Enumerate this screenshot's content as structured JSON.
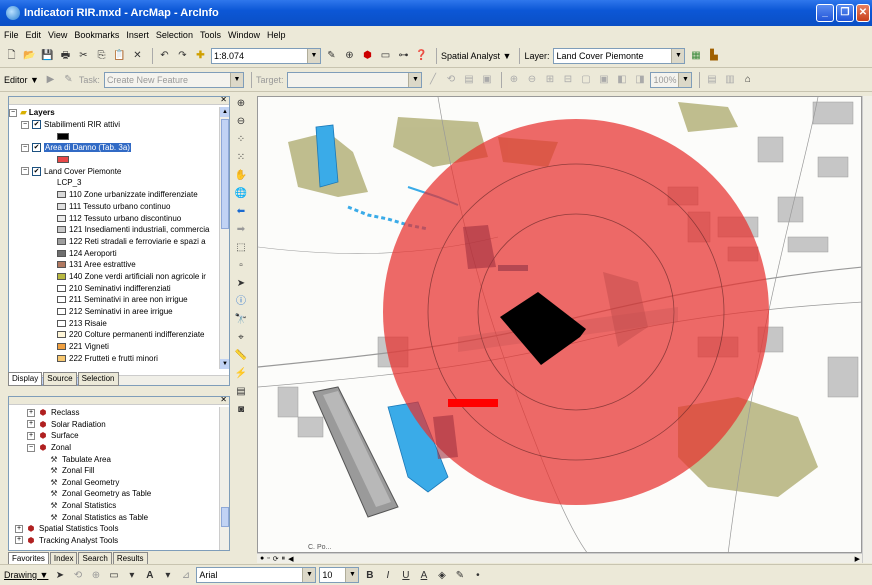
{
  "window": {
    "title": "Indicatori RIR.mxd - ArcMap - ArcInfo"
  },
  "menu": [
    "File",
    "Edit",
    "View",
    "Bookmarks",
    "Insert",
    "Selection",
    "Tools",
    "Window",
    "Help"
  ],
  "standard_toolbar": {
    "scale": "1:8.074",
    "spatial_analyst_label": "Spatial Analyst ▼",
    "layer_label": "Layer:",
    "layer_value": "Land Cover Piemonte"
  },
  "editor_toolbar": {
    "editor_label": "Editor ▼",
    "task_label": "Task:",
    "task_value": "Create New Feature",
    "target_label": "Target:",
    "zoom_value": "100%"
  },
  "toc": {
    "root": "Layers",
    "layer1": "Stabilimenti RIR attivi",
    "layer2": "Area di Danno (Tab. 3a)",
    "layer3": "Land Cover Piemonte",
    "field": "LCP_3",
    "classes": [
      {
        "label": "110 Zone urbanizzate indifferenziate",
        "color": "#d9d9d9"
      },
      {
        "label": "111 Tessuto urbano continuo",
        "color": "#e0e0e0"
      },
      {
        "label": "112 Tessuto urbano discontinuo",
        "color": "#ececec"
      },
      {
        "label": "121 Insediamenti industriali, commercia",
        "color": "#c8c8c8"
      },
      {
        "label": "122 Reti stradali e ferroviarie e spazi a",
        "color": "#9e9e9e"
      },
      {
        "label": "124 Aeroporti",
        "color": "#6e6e6e"
      },
      {
        "label": "131 Aree estrattive",
        "color": "#b07860"
      },
      {
        "label": "140 Zone verdi artificiali non agricole ir",
        "color": "#b8b840"
      },
      {
        "label": "210 Seminativi indifferenziati",
        "color": "#ffffff"
      },
      {
        "label": "211 Seminativi in aree non irrigue",
        "color": "#ffffff"
      },
      {
        "label": "212 Seminativi in aree irrigue",
        "color": "#ffffff"
      },
      {
        "label": "213 Risaie",
        "color": "#ffffff"
      },
      {
        "label": "220 Colture permanenti indifferenziate",
        "color": "#fff6d8"
      },
      {
        "label": "221 Vigneti",
        "color": "#f0a040"
      },
      {
        "label": "222 Frutteti e frutti minori",
        "color": "#f8c870"
      }
    ]
  },
  "toc_tabs": [
    "Display",
    "Source",
    "Selection"
  ],
  "toolbox": {
    "items": [
      {
        "label": "Reclass",
        "type": "toolset"
      },
      {
        "label": "Solar Radiation",
        "type": "toolset"
      },
      {
        "label": "Surface",
        "type": "toolset"
      },
      {
        "label": "Zonal",
        "type": "toolset-open"
      },
      {
        "label": "Tabulate Area",
        "type": "tool"
      },
      {
        "label": "Zonal Fill",
        "type": "tool"
      },
      {
        "label": "Zonal Geometry",
        "type": "tool"
      },
      {
        "label": "Zonal Geometry as Table",
        "type": "tool"
      },
      {
        "label": "Zonal Statistics",
        "type": "tool"
      },
      {
        "label": "Zonal Statistics as Table",
        "type": "tool"
      },
      {
        "label": "Spatial Statistics Tools",
        "type": "toolbox"
      },
      {
        "label": "Tracking Analyst Tools",
        "type": "toolbox"
      }
    ]
  },
  "toolbox_tabs": [
    "Favorites",
    "Index",
    "Search",
    "Results"
  ],
  "drawing_toolbar": {
    "drawing_label": "Drawing ▼",
    "font": "Arial",
    "size": "10"
  },
  "map_labels": {
    "bottom_label": "C. Po..."
  },
  "colors": {
    "buffer": "#e8302e",
    "facility": "#000000",
    "water": "#38a8e8",
    "green": "#a8a870",
    "urban": "#c8c8c8"
  }
}
